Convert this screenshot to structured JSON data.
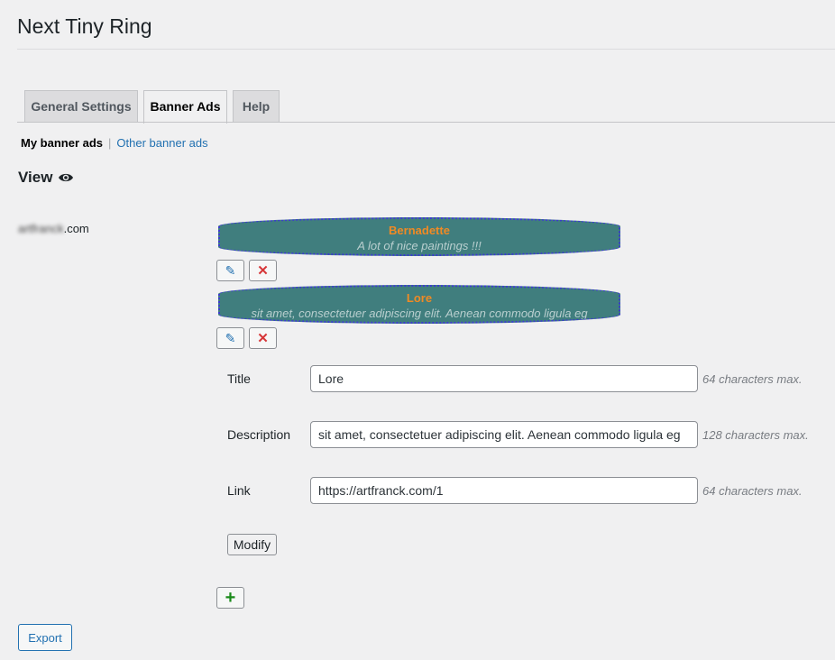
{
  "page": {
    "title": "Next Tiny Ring"
  },
  "tabs": [
    {
      "label": "General Settings",
      "active": false
    },
    {
      "label": "Banner Ads",
      "active": true
    },
    {
      "label": "Help",
      "active": false
    }
  ],
  "subnav": {
    "current": "My banner ads",
    "separator": "|",
    "other": "Other banner ads"
  },
  "view": {
    "label": "View",
    "icon": "eye-icon"
  },
  "site": {
    "blurred_part": "artfranck",
    "suffix": ".com"
  },
  "banners": [
    {
      "title": "Bernadette",
      "description": "A lot of nice paintings !!!"
    },
    {
      "title": "Lore",
      "description": "sit amet, consectetuer adipiscing elit. Aenean commodo ligula eg"
    }
  ],
  "banner_actions": {
    "edit_icon": "pencil-icon",
    "delete_icon": "x-icon"
  },
  "form": {
    "title": {
      "label": "Title",
      "value": "Lore",
      "hint": "64 characters max."
    },
    "description": {
      "label": "Description",
      "value": "sit amet, consectetuer adipiscing elit. Aenean commodo ligula eg",
      "hint": "128 characters max."
    },
    "link": {
      "label": "Link",
      "value": "https://artfranck.com/1",
      "hint": "64 characters max."
    },
    "modify_label": "Modify"
  },
  "add_icon": "plus-icon",
  "export_label": "Export",
  "colors": {
    "banner_bg": "#407e7e",
    "banner_title": "#f08a24",
    "banner_border": "#3d3bd0",
    "link": "#2271b1",
    "delete": "#d63638",
    "add": "#1a8a1a"
  }
}
